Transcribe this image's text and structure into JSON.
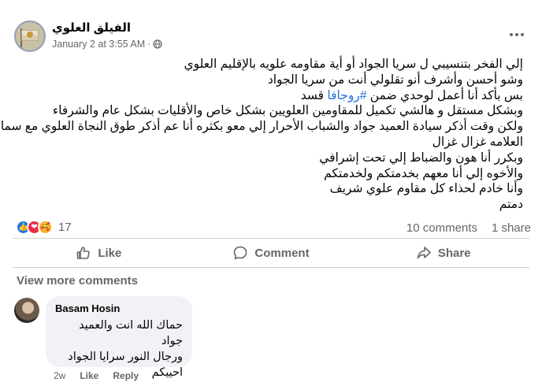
{
  "post": {
    "page_name": "الفيلق العلوي",
    "timestamp": "January 2 at 3:55 AM",
    "separator": "·",
    "lines": [
      "إلي الفخر بتنسيبي ل سريا الجواد أو أية مقاومه علويه بالإقليم العلوي",
      "وشو أحسن وأشرف أنو تقلولي أنت من سريا الجواد",
      "قسد",
      "وبشكل مستقل و هالشي تكميل للمقاومين العلويين بشكل خاص والأقليات بشكل عام والشرفاء",
      "ولكن وقت أذكر سيادة العميد جواد والشباب الأحرار إلي معو بكثره أنا عم أذكر طوق النجاة العلوي مع سماحة",
      "العلامه غزال غزال",
      "وبكرر أنا هون والضباط إلي تحت إشرافي",
      "والأخوه إلي أنا معهم بخدمتكم ولخدمتكم",
      "وأنا خادم لحذاء كل مقاوم علوي شريف",
      "دمتم"
    ],
    "line3_prefix": "بس بأكد أنا أعمل لوحدي ضمن ",
    "hashtag": "#روجافا",
    "line3_suffix": " قسد"
  },
  "stats": {
    "reaction_count": "17",
    "comments": "10 comments",
    "shares": "1 share"
  },
  "actions": {
    "like": "Like",
    "comment": "Comment",
    "share": "Share"
  },
  "comments_section": {
    "view_more": "View more comments",
    "comment": {
      "author": "Basam Hosin",
      "lines": [
        "حماك الله انت والعميد جواد",
        "ورجال النور سرايا الجواد",
        "احييكم"
      ],
      "age": "2w",
      "like": "Like",
      "reply": "Reply"
    }
  },
  "colors": {
    "link": "#216fdb",
    "like_reaction": "#1877f2",
    "love_reaction": "#f02849",
    "care_reaction": "#f7b125",
    "secondary_text": "#65676b"
  }
}
